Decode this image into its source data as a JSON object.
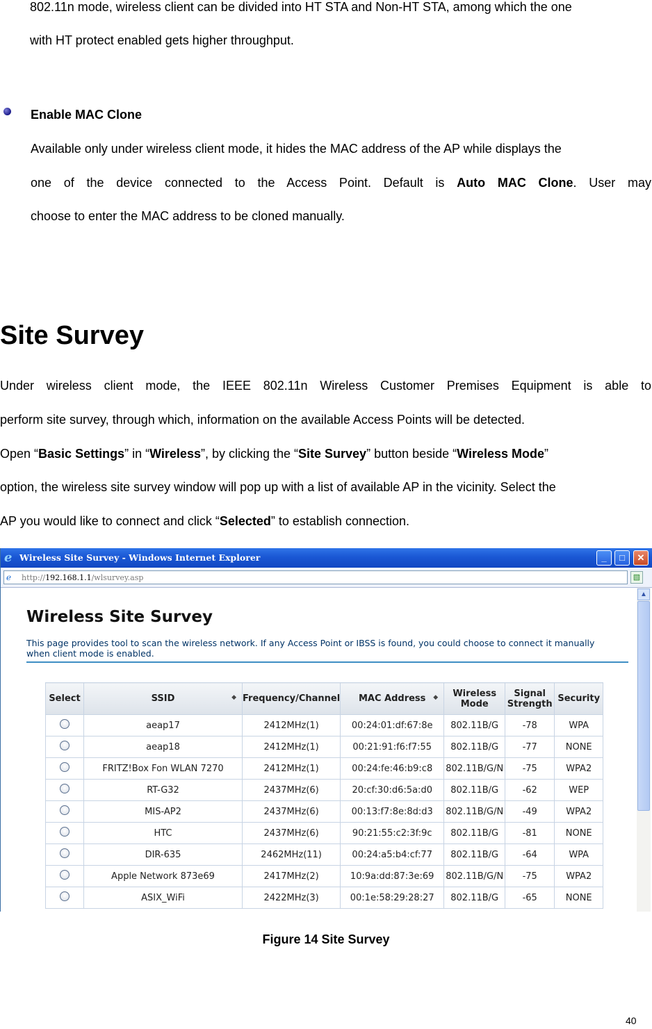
{
  "intro_line1": "802.11n mode, wireless client can be divided into HT STA and Non-HT STA, among which the one",
  "intro_line2": "with HT protect enabled gets higher throughput.",
  "mac_clone": {
    "heading": "Enable MAC Clone",
    "line1": "Available only under wireless client mode, it hides the MAC address of the AP while displays the",
    "line2_a": "one of the device connected to the Access Point.  Default is ",
    "line2_bold": "Auto MAC Clone",
    "line2_b": ".  User may",
    "line3": "choose to enter the MAC address to be cloned manually."
  },
  "section_title": "Site Survey",
  "para1_line1": "Under wireless client mode, the IEEE 802.11n Wireless Customer Premises Equipment is able to",
  "para1_line2": "perform site survey, through which, information on the available Access Points will be detected.",
  "para2": {
    "t1": "Open “",
    "b1": "Basic Settings",
    "t2": "” in “",
    "b2": "Wireless",
    "t3": "”, by clicking the “",
    "b3": "Site Survey",
    "t4": "” button beside “",
    "b4": "Wireless Mode",
    "t5": "”",
    "line2": "option, the wireless site survey window will pop up with a list of available AP in the vicinity.   Select the",
    "line3_a": "AP you would like to connect and click “",
    "line3_bold": "Selected",
    "line3_b": "” to establish connection."
  },
  "browser": {
    "title": "Wireless Site Survey - Windows Internet Explorer",
    "url_prefix": "http://",
    "url_host": "192.168.1.1",
    "url_path": "/wlsurvey.asp",
    "min": "_",
    "max": "□",
    "close": "✕",
    "colors": {
      "titlebar": "#1a57d4",
      "header_line": "#3e8ec4"
    }
  },
  "survey": {
    "title": "Wireless Site Survey",
    "description": "This page provides tool to scan the wireless network. If any Access Point or IBSS is found, you could choose to connect it manually when client mode is enabled.",
    "headers": {
      "select": "Select",
      "ssid": "SSID",
      "frequency": "Frequency/Channel",
      "mac": "MAC Address",
      "mode": "Wireless Mode",
      "signal": "Signal Strength",
      "security": "Security"
    },
    "rows": [
      [
        "aeap17",
        "2412MHz(1)",
        "00:24:01:df:67:8e",
        "802.11B/G",
        "-78",
        "WPA"
      ],
      [
        "aeap18",
        "2412MHz(1)",
        "00:21:91:f6:f7:55",
        "802.11B/G",
        "-77",
        "NONE"
      ],
      [
        "FRITZ!Box Fon WLAN 7270",
        "2412MHz(1)",
        "00:24:fe:46:b9:c8",
        "802.11B/G/N",
        "-75",
        "WPA2"
      ],
      [
        "RT-G32",
        "2437MHz(6)",
        "20:cf:30:d6:5a:d0",
        "802.11B/G",
        "-62",
        "WEP"
      ],
      [
        "MIS-AP2",
        "2437MHz(6)",
        "00:13:f7:8e:8d:d3",
        "802.11B/G/N",
        "-49",
        "WPA2"
      ],
      [
        "HTC",
        "2437MHz(6)",
        "90:21:55:c2:3f:9c",
        "802.11B/G",
        "-81",
        "NONE"
      ],
      [
        "DIR-635",
        "2462MHz(11)",
        "00:24:a5:b4:cf:77",
        "802.11B/G",
        "-64",
        "WPA"
      ],
      [
        "Apple Network 873e69",
        "2417MHz(2)",
        "10:9a:dd:87:3e:69",
        "802.11B/G/N",
        "-75",
        "WPA2"
      ],
      [
        "ASIX_WiFi",
        "2422MHz(3)",
        "00:1e:58:29:28:27",
        "802.11B/G",
        "-65",
        "NONE"
      ]
    ]
  },
  "caption": "Figure 14 Site Survey",
  "page_number": "40"
}
